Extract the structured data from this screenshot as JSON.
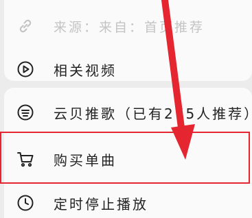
{
  "menu": {
    "source_label": "来源：来自：首页推荐",
    "video_label": "相关视频",
    "recommend_label": "云贝推歌（已有275人推荐）",
    "buy_label": "购买单曲",
    "timer_label": "定时停止播放"
  },
  "icons": {
    "source": "link-icon",
    "video": "play-circle-icon",
    "recommend": "cloud-coin-icon",
    "buy": "cart-icon",
    "timer": "clock-icon"
  },
  "colors": {
    "highlight": "#e5252f",
    "text": "#222222",
    "muted": "#c4c4c4"
  }
}
